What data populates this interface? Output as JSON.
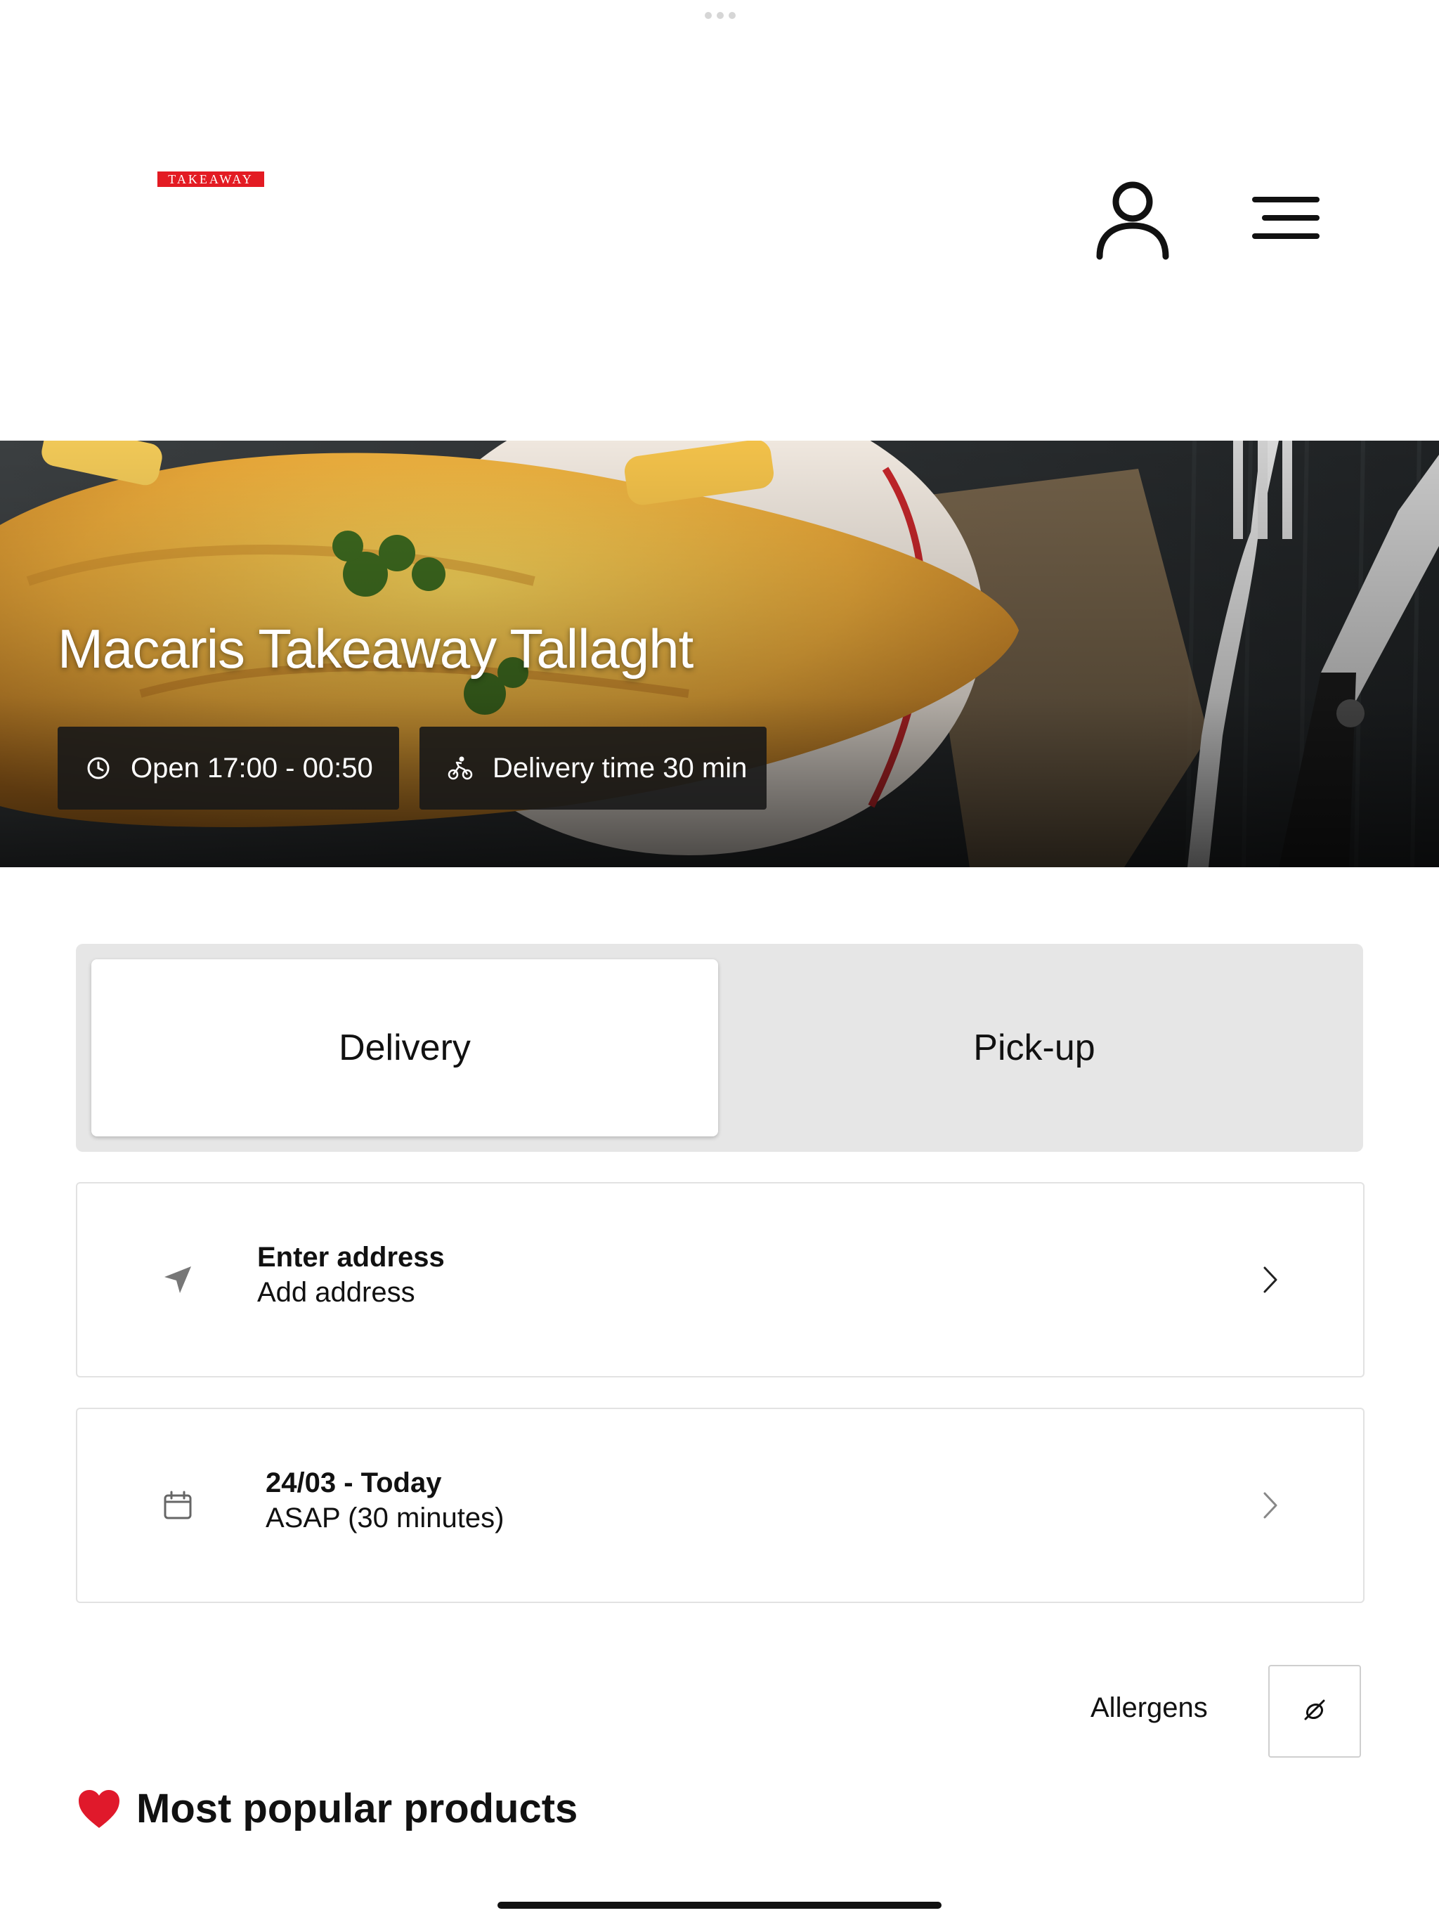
{
  "header": {
    "logo_text": "TAKEAWAY",
    "logo_color": "#e31b23",
    "icons": [
      "user-icon",
      "menu-icon"
    ]
  },
  "hero": {
    "title": "Macaris Takeaway Tallaght",
    "open_hours": "Open 17:00 - 00:50",
    "delivery_time": "Delivery time 30 min",
    "icons": [
      "clock-icon",
      "bicycle-icon"
    ]
  },
  "order_type": {
    "tabs": [
      {
        "label": "Delivery",
        "selected": true
      },
      {
        "label": "Pick-up",
        "selected": false
      }
    ]
  },
  "address": {
    "title": "Enter address",
    "subtitle": "Add address",
    "icon": "location-arrow-icon"
  },
  "time": {
    "title": "24/03 - Today",
    "subtitle": "ASAP (30 minutes)",
    "icon": "calendar-icon"
  },
  "allergens": {
    "label": "Allergens",
    "icon": "allergen-icon"
  },
  "popular": {
    "title": "Most popular products",
    "icon": "heart-icon"
  }
}
